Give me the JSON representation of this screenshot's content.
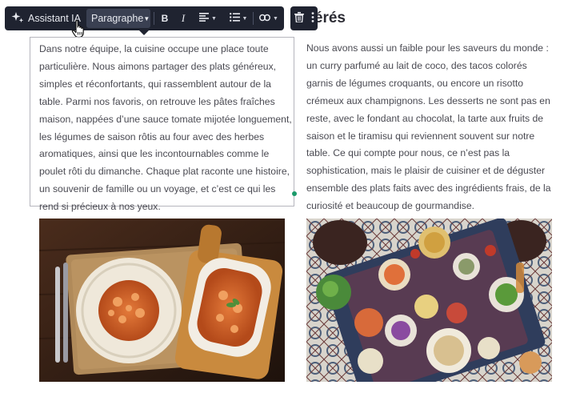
{
  "heading": {
    "text": "éférés"
  },
  "toolbar": {
    "ai_label": "Assistant IA",
    "paragraph_label": "Paragraphe",
    "bold_label": "B",
    "italic_label": "I",
    "icons": [
      "sparkle-icon",
      "chevron-down-icon",
      "align-left-icon",
      "bullet-list-icon",
      "link-icon",
      "trash-icon",
      "more-vertical-icon"
    ]
  },
  "content": {
    "left_paragraph": "Dans notre équipe, la cuisine occupe une place toute particulière. Nous aimons partager des plats généreux, simples et réconfortants, qui rassemblent autour de la table. Parmi nos favoris, on retrouve les pâtes fraîches maison, nappées d’une sauce tomate mijotée longuement, les légumes de saison rôtis au four avec des herbes aromatiques, ainsi que les incontournables comme le poulet rôti du dimanche. Chaque plat raconte une histoire, un souvenir de famille ou un voyage, et c’est ce qui les rend si précieux à nos yeux.",
    "right_paragraph": "Nous avons aussi un faible pour les saveurs du monde : un curry parfumé au lait de coco, des tacos colorés garnis de légumes croquants, ou encore un risotto crémeux aux champignons. Les desserts ne sont pas en reste, avec le fondant au chocolat, la tarte aux fruits de saison et le tiramisu qui reviennent souvent sur notre table. Ce qui compte pour nous, ce n’est pas la sophistication, mais le plaisir de cuisiner et de déguster ensemble des plats faits avec des ingrédients frais, de la curiosité et beaucoup de gourmandise."
  },
  "colors": {
    "toolbar_bg": "#1f2330",
    "selection_border": "#b6b6bd",
    "handle": "#1b9a6a"
  }
}
